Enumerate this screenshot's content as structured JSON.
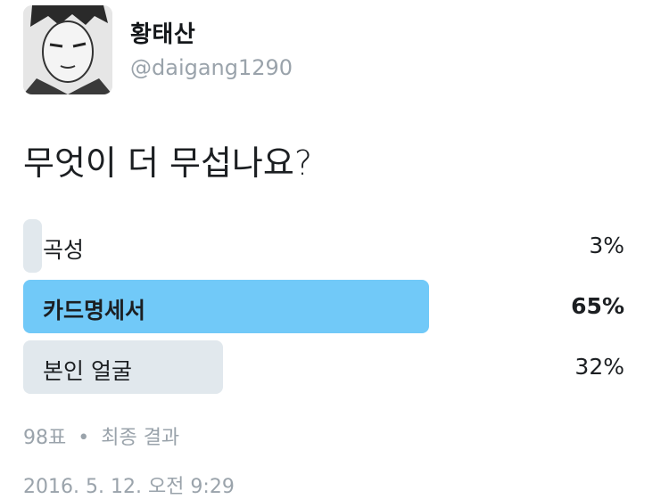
{
  "profile": {
    "display_name": "황태산",
    "handle": "@daigang1290"
  },
  "tweet": {
    "question": "무엇이 더 무섭나요?"
  },
  "poll": {
    "options": [
      {
        "label": "곡성",
        "percent": "3%",
        "value": 3
      },
      {
        "label": "카드명세서",
        "percent": "65%",
        "value": 65
      },
      {
        "label": "본인 얼굴",
        "percent": "32%",
        "value": 32
      }
    ],
    "votes": "98표",
    "separator": "•",
    "status": "최종 결과"
  },
  "timestamp": "2016. 5. 12. 오전 9:29",
  "colors": {
    "winner_bar": "#71c9f8",
    "bar": "#e1e8ed",
    "muted_text": "#9aa3ab"
  }
}
